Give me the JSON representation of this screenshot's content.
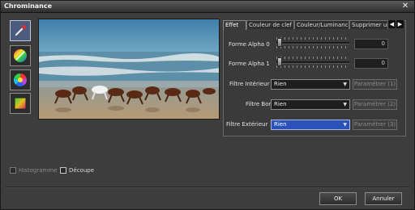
{
  "window": {
    "title": "Chrominance",
    "close_glyph": "✕"
  },
  "tools": [
    {
      "name": "eyedropper-icon",
      "selected": true
    },
    {
      "name": "color-wheel-brush-icon",
      "selected": false
    },
    {
      "name": "color-wheel-icon",
      "selected": false
    },
    {
      "name": "gradient-square-icon",
      "selected": false
    }
  ],
  "tabs": [
    {
      "label": "Effet",
      "active": true
    },
    {
      "label": "Couleur de clef",
      "active": false
    },
    {
      "label": "Couleur/Luminance",
      "active": false
    },
    {
      "label": "Supprimer un",
      "active": false
    }
  ],
  "tab_arrows": {
    "left": "◀",
    "right": "▶"
  },
  "effect": {
    "alpha0": {
      "label": "Forme Alpha 0",
      "value": "0"
    },
    "alpha1": {
      "label": "Forme Alpha 1",
      "value": "0"
    },
    "filters": [
      {
        "label": "Filtre Intérieur",
        "value": "Rien",
        "button": "Paramétrer (1)"
      },
      {
        "label": "Filtre Bord",
        "value": "Rien",
        "button": "Paramétrer (2)"
      },
      {
        "label": "Filtre Extérieur",
        "value": "Rien",
        "button": "Paramétrer (3)"
      }
    ]
  },
  "checkboxes": {
    "histogram": {
      "label": "Histogramme",
      "checked": false,
      "enabled": false
    },
    "crop": {
      "label": "Découpe",
      "checked": false,
      "enabled": true
    }
  },
  "buttons": {
    "ok": "OK",
    "cancel": "Annuler"
  }
}
